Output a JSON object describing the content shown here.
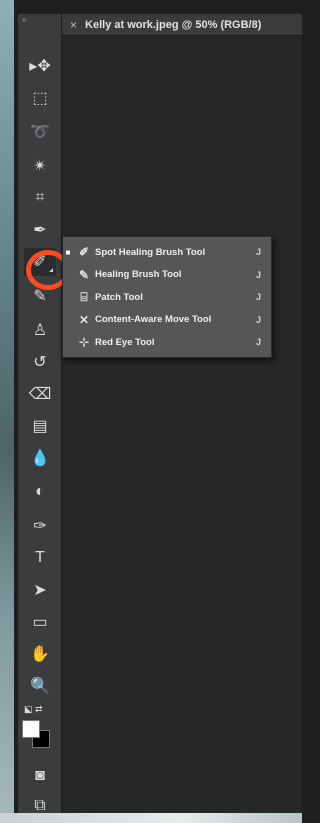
{
  "document": {
    "tab_title": "Kelly at work.jpeg @ 50% (RGB/8)",
    "close_glyph": "×"
  },
  "toolbar": {
    "grip": "»",
    "tools": [
      {
        "name": "move-tool",
        "icon": "▸✥"
      },
      {
        "name": "marquee-tool",
        "icon": "⬚"
      },
      {
        "name": "lasso-tool",
        "icon": "➰"
      },
      {
        "name": "magic-wand-tool",
        "icon": "✴"
      },
      {
        "name": "crop-tool",
        "icon": "⌗"
      },
      {
        "name": "eyedropper-tool",
        "icon": "✒"
      },
      {
        "name": "spot-healing-tool",
        "icon": "✐"
      },
      {
        "name": "brush-tool",
        "icon": "✎"
      },
      {
        "name": "clone-stamp-tool",
        "icon": "♙"
      },
      {
        "name": "history-brush-tool",
        "icon": "↺"
      },
      {
        "name": "eraser-tool",
        "icon": "⌫"
      },
      {
        "name": "gradient-tool",
        "icon": "▤"
      },
      {
        "name": "blur-tool",
        "icon": "💧"
      },
      {
        "name": "dodge-tool",
        "icon": "◐"
      },
      {
        "name": "pen-tool",
        "icon": "✑"
      },
      {
        "name": "type-tool",
        "icon": "T"
      },
      {
        "name": "path-selection-tool",
        "icon": "➤"
      },
      {
        "name": "shape-tool",
        "icon": "▭"
      },
      {
        "name": "hand-tool",
        "icon": "✋"
      },
      {
        "name": "zoom-tool",
        "icon": "🔍"
      },
      {
        "name": "quick-mask-button",
        "icon": "◙"
      },
      {
        "name": "screen-mode-button",
        "icon": "⧉"
      }
    ],
    "swatch_reset": "⬕ ⇄",
    "foreground_color": "#ffffff",
    "background_color": "#000000"
  },
  "flyout": {
    "items": [
      {
        "label": "Spot Healing Brush Tool",
        "key": "J",
        "selected": true,
        "icon": "✐"
      },
      {
        "label": "Healing Brush Tool",
        "key": "J",
        "selected": false,
        "icon": "✎"
      },
      {
        "label": "Patch Tool",
        "key": "J",
        "selected": false,
        "icon": "⌸"
      },
      {
        "label": "Content-Aware Move Tool",
        "key": "J",
        "selected": false,
        "icon": "✕"
      },
      {
        "label": "Red Eye Tool",
        "key": "J",
        "selected": false,
        "icon": "⊹"
      }
    ],
    "selected_bullet": "■"
  },
  "annotation": {
    "ring_color": "#ff4a22"
  }
}
